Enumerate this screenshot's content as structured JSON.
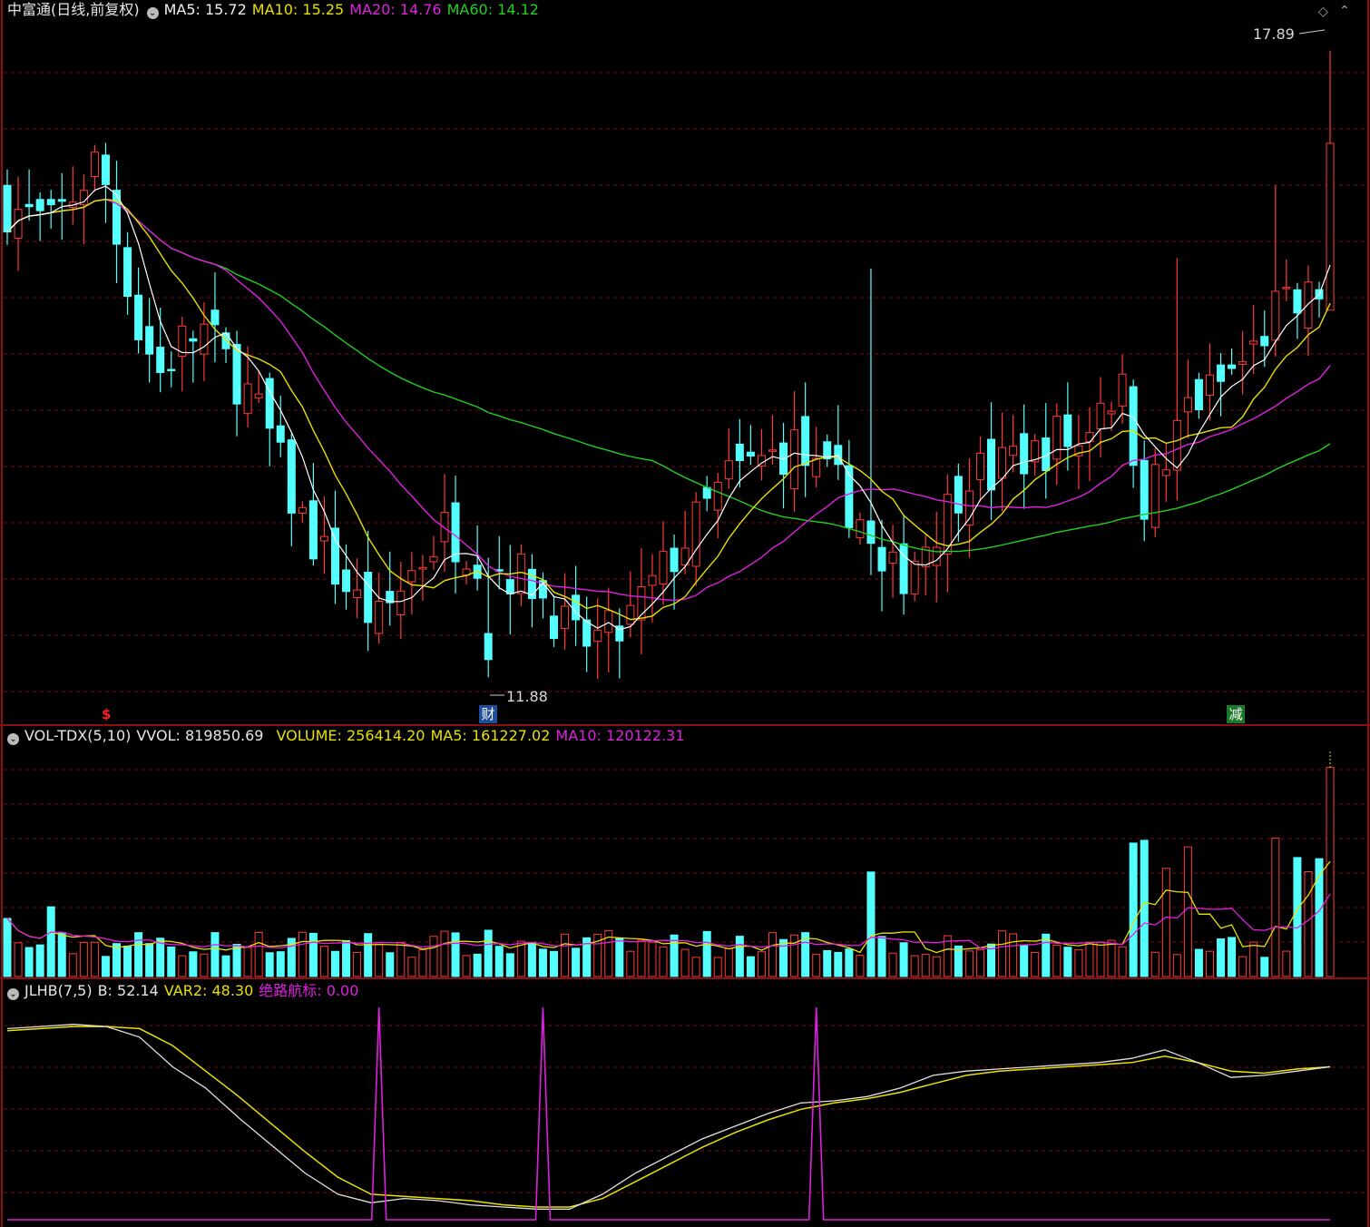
{
  "main": {
    "title": "中富通(日线,前复权)",
    "ma5_label": "MA5: 15.72",
    "ma10_label": "MA10: 15.25",
    "ma20_label": "MA20: 14.76",
    "ma60_label": "MA60: 14.12",
    "high_marker": "17.89",
    "low_marker": "11.88",
    "event_left": "$",
    "event_mid": "财",
    "event_right": "减"
  },
  "volume": {
    "title": "VOL-TDX(5,10)",
    "vvol_label": "VVOL: 819850.69",
    "volume_label": "VOLUME: 256414.20",
    "ma5_label": "MA5: 161227.02",
    "ma10_label": "MA10: 120122.31"
  },
  "indicator": {
    "title": "JLHB(7,5)",
    "b_label": "B: 52.14",
    "var2_label": "VAR2: 48.30",
    "signal_label": "绝路航标: 0.00"
  },
  "colors": {
    "up": "#ff3a3a",
    "down": "#54ffff",
    "ma5": "#ffffff",
    "ma10": "#e8e000",
    "ma20": "#e020e0",
    "ma60": "#20d020",
    "grid": "#7a0c0c",
    "frame": "#8c0f0f"
  },
  "chart_data": [
    {
      "type": "candlestick",
      "title": "中富通(日线,前复权)",
      "price_range": [
        11.5,
        18.2
      ],
      "days": 122,
      "close_anchors": [
        [
          0,
          16.4
        ],
        [
          4,
          16.2
        ],
        [
          6,
          16.5
        ],
        [
          8,
          16.8
        ],
        [
          9,
          16.6
        ],
        [
          10,
          16.1
        ],
        [
          11,
          15.7
        ],
        [
          12,
          15.2
        ],
        [
          14,
          14.8
        ],
        [
          16,
          15.1
        ],
        [
          18,
          15.2
        ],
        [
          20,
          14.9
        ],
        [
          22,
          14.6
        ],
        [
          24,
          14.2
        ],
        [
          26,
          13.6
        ],
        [
          28,
          13.2
        ],
        [
          30,
          12.9
        ],
        [
          32,
          12.6
        ],
        [
          34,
          12.4
        ],
        [
          37,
          12.9
        ],
        [
          40,
          13.3
        ],
        [
          44,
          13.0
        ],
        [
          48,
          12.8
        ],
        [
          52,
          12.2
        ],
        [
          56,
          12.3
        ],
        [
          60,
          12.9
        ],
        [
          64,
          13.5
        ],
        [
          66,
          13.8
        ],
        [
          68,
          13.9
        ],
        [
          72,
          14.1
        ],
        [
          74,
          13.8
        ],
        [
          76,
          13.7
        ],
        [
          78,
          13.4
        ],
        [
          80,
          12.8
        ],
        [
          82,
          12.9
        ],
        [
          84,
          13.2
        ],
        [
          86,
          13.5
        ],
        [
          88,
          13.9
        ],
        [
          90,
          13.8
        ],
        [
          92,
          14.0
        ],
        [
          94,
          14.0
        ],
        [
          96,
          14.2
        ],
        [
          98,
          14.1
        ],
        [
          100,
          14.6
        ],
        [
          102,
          14.6
        ],
        [
          104,
          13.6
        ],
        [
          106,
          13.9
        ],
        [
          108,
          14.5
        ],
        [
          110,
          14.6
        ],
        [
          112,
          14.8
        ],
        [
          114,
          15.0
        ],
        [
          116,
          15.4
        ],
        [
          118,
          15.4
        ],
        [
          120,
          15.6
        ],
        [
          121,
          17.0
        ]
      ],
      "high": 17.89,
      "low": 11.88
    },
    {
      "type": "bar",
      "title": "VOL-TDX(5,10)",
      "series": [
        {
          "name": "VOLUME",
          "last": 256414.2
        },
        {
          "name": "MA5",
          "last": 161227.02
        },
        {
          "name": "MA10",
          "last": 120122.31
        }
      ],
      "vvol": 819850.69
    },
    {
      "type": "line",
      "title": "JLHB(7,5)",
      "series": [
        {
          "name": "B",
          "last": 52.14,
          "values": [
            90,
            91,
            92,
            91,
            86,
            72,
            62,
            48,
            35,
            22,
            12,
            8,
            10,
            9,
            7,
            6,
            5,
            5,
            12,
            22,
            30,
            38,
            44,
            50,
            55,
            56,
            58,
            62,
            68,
            70,
            71,
            72,
            73,
            74,
            76,
            80,
            74,
            67,
            68,
            70,
            72
          ]
        },
        {
          "name": "VAR2",
          "last": 48.3,
          "values": [
            89,
            90,
            91,
            91,
            90,
            82,
            70,
            58,
            45,
            32,
            20,
            12,
            11,
            10,
            9,
            7,
            6,
            6,
            10,
            18,
            26,
            34,
            41,
            47,
            52,
            55,
            57,
            60,
            64,
            68,
            70,
            71,
            72,
            73,
            74,
            77,
            74,
            70,
            69,
            71,
            72
          ]
        },
        {
          "name": "绝路航标",
          "last": 0.0,
          "spikes_at_day": [
            34,
            49,
            74
          ]
        }
      ],
      "ylim": [
        0,
        100
      ]
    }
  ]
}
